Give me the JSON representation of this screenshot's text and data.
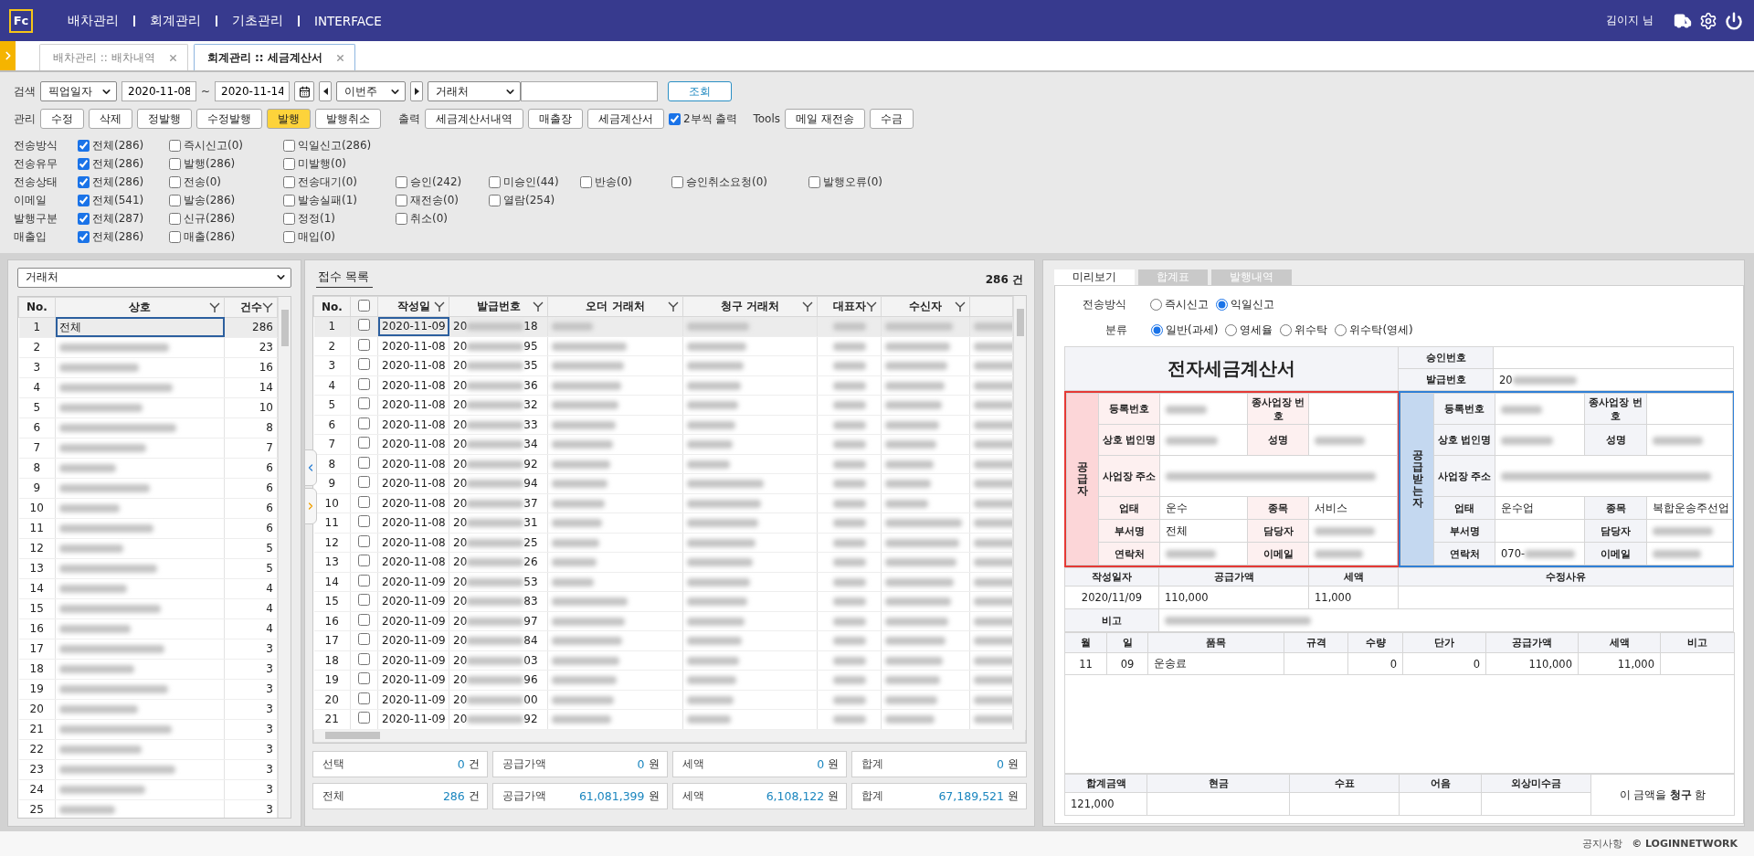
{
  "header": {
    "logo": "Fc",
    "menu": [
      {
        "label": "배차관리"
      },
      {
        "label": "회계관리"
      },
      {
        "label": "기초관리"
      },
      {
        "label": "INTERFACE"
      }
    ],
    "user": "김이지 님"
  },
  "tabs": [
    {
      "label": "배차관리 :: 배차내역",
      "selected": false
    },
    {
      "label": "회계관리 :: 세금계산서",
      "selected": true
    }
  ],
  "search": {
    "label": "검색",
    "date_type": "픽업일자",
    "date_from": "2020-11-08",
    "range_separator": "~",
    "date_to": "2020-11-14",
    "period": "이번주",
    "partner_type": "거래처",
    "button": "조회"
  },
  "manage": {
    "label": "관리",
    "buttons": [
      {
        "label": "수정",
        "highlighted": false
      },
      {
        "label": "삭제",
        "highlighted": false
      },
      {
        "label": "정발행",
        "highlighted": false
      },
      {
        "label": "수정발행",
        "highlighted": false
      },
      {
        "label": "발행",
        "highlighted": true
      },
      {
        "label": "발행취소",
        "highlighted": false
      }
    ]
  },
  "output": {
    "label": "출력",
    "buttons": [
      "세금계산서내역",
      "매출장",
      "세금계산서"
    ],
    "two_copies": {
      "label": "2부씩 출력",
      "checked": true
    }
  },
  "tools": {
    "label": "Tools",
    "buttons": [
      "메일 재전송",
      "수금"
    ]
  },
  "filters": [
    {
      "label": "전송방식",
      "options": [
        {
          "label": "전체(286)",
          "checked": true
        },
        {
          "label": "즉시신고(0)",
          "checked": false
        },
        {
          "label": "익일신고(286)",
          "checked": false
        }
      ]
    },
    {
      "label": "전송유무",
      "options": [
        {
          "label": "전체(286)",
          "checked": true
        },
        {
          "label": "발행(286)",
          "checked": false
        },
        {
          "label": "미발행(0)",
          "checked": false
        }
      ]
    },
    {
      "label": "전송상태",
      "options": [
        {
          "label": "전체(286)",
          "checked": true
        },
        {
          "label": "전송(0)",
          "checked": false
        },
        {
          "label": "전송대기(0)",
          "checked": false
        },
        {
          "label": "승인(242)",
          "checked": false
        },
        {
          "label": "미승인(44)",
          "checked": false
        },
        {
          "label": "반송(0)",
          "checked": false
        },
        {
          "label": "승인취소요청(0)",
          "checked": false
        },
        {
          "label": "발행오류(0)",
          "checked": false
        }
      ]
    },
    {
      "label": "이메일",
      "options": [
        {
          "label": "전체(541)",
          "checked": true
        },
        {
          "label": "발송(286)",
          "checked": false
        },
        {
          "label": "발송실패(1)",
          "checked": false
        },
        {
          "label": "재전송(0)",
          "checked": false
        },
        {
          "label": "열람(254)",
          "checked": false
        }
      ]
    },
    {
      "label": "발행구분",
      "options": [
        {
          "label": "전체(287)",
          "checked": true
        },
        {
          "label": "신규(286)",
          "checked": false
        },
        {
          "label": "정정(1)",
          "checked": false
        },
        {
          "label": "취소(0)",
          "checked": false
        }
      ]
    },
    {
      "label": "매출입",
      "options": [
        {
          "label": "전체(286)",
          "checked": true
        },
        {
          "label": "매출(286)",
          "checked": false
        },
        {
          "label": "매입(0)",
          "checked": false
        }
      ]
    }
  ],
  "partner_list": {
    "selector": "거래처",
    "columns": [
      {
        "label": "No.",
        "filter": false
      },
      {
        "label": "상호",
        "filter": true
      },
      {
        "label": "건수",
        "filter": true
      }
    ],
    "rows": [
      {
        "no": "1",
        "name": "전체",
        "count": "286",
        "selected": true
      },
      {
        "no": "2",
        "count": "23",
        "selected": false
      },
      {
        "no": "3",
        "count": "16",
        "selected": false
      },
      {
        "no": "4",
        "count": "14",
        "selected": false
      },
      {
        "no": "5",
        "count": "10",
        "selected": false
      },
      {
        "no": "6",
        "count": "8",
        "selected": false
      },
      {
        "no": "7",
        "count": "7",
        "selected": false
      },
      {
        "no": "8",
        "count": "6",
        "selected": false
      },
      {
        "no": "9",
        "count": "6",
        "selected": false
      },
      {
        "no": "10",
        "count": "6",
        "selected": false
      },
      {
        "no": "11",
        "count": "6",
        "selected": false
      },
      {
        "no": "12",
        "count": "5",
        "selected": false
      },
      {
        "no": "13",
        "count": "5",
        "selected": false
      },
      {
        "no": "14",
        "count": "4",
        "selected": false
      },
      {
        "no": "15",
        "count": "4",
        "selected": false
      },
      {
        "no": "16",
        "count": "4",
        "selected": false
      },
      {
        "no": "17",
        "count": "3",
        "selected": false
      },
      {
        "no": "18",
        "count": "3",
        "selected": false
      },
      {
        "no": "19",
        "count": "3",
        "selected": false
      },
      {
        "no": "20",
        "count": "3",
        "selected": false
      },
      {
        "no": "21",
        "count": "3",
        "selected": false
      },
      {
        "no": "22",
        "count": "3",
        "selected": false
      },
      {
        "no": "23",
        "count": "3",
        "selected": false
      },
      {
        "no": "24",
        "count": "3",
        "selected": false
      },
      {
        "no": "25",
        "count": "3",
        "selected": false
      }
    ]
  },
  "receipt_list": {
    "title": "접수 목록",
    "count": "286 건",
    "no_label": "No.",
    "header_checked": false,
    "columns": [
      {
        "label": "작성일",
        "filter": true
      },
      {
        "label": "발급번호",
        "filter": true
      },
      {
        "label": "오더 거래처",
        "filter": true
      },
      {
        "label": "청구 거래처",
        "filter": true
      },
      {
        "label": "대표자",
        "filter": true
      },
      {
        "label": "수신자",
        "filter": true
      }
    ],
    "rows": [
      {
        "no": "1",
        "checked": false,
        "date": "2020-11-09",
        "issue_prefix": "20",
        "issue_suffix": "18",
        "selected": true
      },
      {
        "no": "2",
        "checked": false,
        "date": "2020-11-08",
        "issue_prefix": "20",
        "issue_suffix": "95",
        "selected": false
      },
      {
        "no": "3",
        "checked": false,
        "date": "2020-11-08",
        "issue_prefix": "20",
        "issue_suffix": "35",
        "selected": false
      },
      {
        "no": "4",
        "checked": false,
        "date": "2020-11-08",
        "issue_prefix": "20",
        "issue_suffix": "36",
        "selected": false
      },
      {
        "no": "5",
        "checked": false,
        "date": "2020-11-08",
        "issue_prefix": "20",
        "issue_suffix": "32",
        "selected": false
      },
      {
        "no": "6",
        "checked": false,
        "date": "2020-11-08",
        "issue_prefix": "20",
        "issue_suffix": "33",
        "selected": false
      },
      {
        "no": "7",
        "checked": false,
        "date": "2020-11-08",
        "issue_prefix": "20",
        "issue_suffix": "34",
        "selected": false
      },
      {
        "no": "8",
        "checked": false,
        "date": "2020-11-08",
        "issue_prefix": "20",
        "issue_suffix": "92",
        "selected": false
      },
      {
        "no": "9",
        "checked": false,
        "date": "2020-11-08",
        "issue_prefix": "20",
        "issue_suffix": "94",
        "selected": false
      },
      {
        "no": "10",
        "checked": false,
        "date": "2020-11-08",
        "issue_prefix": "20",
        "issue_suffix": "37",
        "selected": false
      },
      {
        "no": "11",
        "checked": false,
        "date": "2020-11-08",
        "issue_prefix": "20",
        "issue_suffix": "31",
        "selected": false
      },
      {
        "no": "12",
        "checked": false,
        "date": "2020-11-08",
        "issue_prefix": "20",
        "issue_suffix": "25",
        "selected": false
      },
      {
        "no": "13",
        "checked": false,
        "date": "2020-11-08",
        "issue_prefix": "20",
        "issue_suffix": "26",
        "selected": false
      },
      {
        "no": "14",
        "checked": false,
        "date": "2020-11-09",
        "issue_prefix": "20",
        "issue_suffix": "53",
        "selected": false
      },
      {
        "no": "15",
        "checked": false,
        "date": "2020-11-09",
        "issue_prefix": "20",
        "issue_suffix": "83",
        "selected": false
      },
      {
        "no": "16",
        "checked": false,
        "date": "2020-11-09",
        "issue_prefix": "20",
        "issue_suffix": "97",
        "selected": false
      },
      {
        "no": "17",
        "checked": false,
        "date": "2020-11-09",
        "issue_prefix": "20",
        "issue_suffix": "84",
        "selected": false
      },
      {
        "no": "18",
        "checked": false,
        "date": "2020-11-09",
        "issue_prefix": "20",
        "issue_suffix": "03",
        "selected": false
      },
      {
        "no": "19",
        "checked": false,
        "date": "2020-11-09",
        "issue_prefix": "20",
        "issue_suffix": "96",
        "selected": false
      },
      {
        "no": "20",
        "checked": false,
        "date": "2020-11-09",
        "issue_prefix": "20",
        "issue_suffix": "00",
        "selected": false
      },
      {
        "no": "21",
        "checked": false,
        "date": "2020-11-09",
        "issue_prefix": "20",
        "issue_suffix": "92",
        "selected": false
      }
    ],
    "summary": [
      {
        "label": "선택",
        "value": "0",
        "unit": "건"
      },
      {
        "label": "공급가액",
        "value": "0",
        "unit": "원"
      },
      {
        "label": "세액",
        "value": "0",
        "unit": "원"
      },
      {
        "label": "합계",
        "value": "0",
        "unit": "원"
      },
      {
        "label": "전체",
        "value": "286",
        "unit": "건"
      },
      {
        "label": "공급가액",
        "value": "61,081,399",
        "unit": "원"
      },
      {
        "label": "세액",
        "value": "6,108,122",
        "unit": "원"
      },
      {
        "label": "합계",
        "value": "67,189,521",
        "unit": "원"
      }
    ]
  },
  "preview": {
    "tabs": [
      {
        "label": "미리보기",
        "selected": true
      },
      {
        "label": "합계표",
        "selected": false
      },
      {
        "label": "발행내역",
        "selected": false
      }
    ],
    "send_method": {
      "label": "전송방식",
      "options": [
        {
          "label": "즉시신고",
          "selected": false
        },
        {
          "label": "익일신고",
          "selected": true
        }
      ]
    },
    "category": {
      "label": "분류",
      "options": [
        {
          "label": "일반(과세)",
          "selected": true
        },
        {
          "label": "영세율",
          "selected": false
        },
        {
          "label": "위수탁",
          "selected": false
        },
        {
          "label": "위수탁(영세)",
          "selected": false
        }
      ]
    },
    "invoice": {
      "title": "전자세금계산서",
      "approval_label": "승인번호",
      "issue_label": "발급번호",
      "issue_value": "20",
      "supplier": {
        "side_label": "공급자",
        "rows": [
          {
            "fields": [
              {
                "label": "등록번호",
                "redacted": true
              },
              {
                "label": "종사업장 번호"
              }
            ]
          },
          {
            "fields": [
              {
                "label": "상호 법인명",
                "redacted": true
              },
              {
                "label": "성명",
                "redacted": true
              }
            ]
          },
          {
            "fields": [
              {
                "label": "사업장 주소",
                "redacted": true
              }
            ]
          },
          {
            "fields": [
              {
                "label": "업태",
                "value": "운수"
              },
              {
                "label": "종목",
                "value": "서비스"
              }
            ]
          },
          {
            "fields": [
              {
                "label": "부서명",
                "value": "전체"
              },
              {
                "label": "담당자",
                "redacted": true
              }
            ]
          },
          {
            "fields": [
              {
                "label": "연락처",
                "redacted": true
              },
              {
                "label": "이메일",
                "redacted": true
              }
            ]
          }
        ]
      },
      "receiver": {
        "side_label": "공급받는자",
        "rows": [
          {
            "fields": [
              {
                "label": "등록번호",
                "redacted": true
              },
              {
                "label": "종사업장 번호"
              }
            ]
          },
          {
            "fields": [
              {
                "label": "상호 법인명",
                "redacted": true
              },
              {
                "label": "성명",
                "redacted": true
              }
            ]
          },
          {
            "fields": [
              {
                "label": "사업장 주소",
                "redacted": true
              }
            ]
          },
          {
            "fields": [
              {
                "label": "업태",
                "value": "운수업"
              },
              {
                "label": "종목",
                "value": "복합운송주선업"
              }
            ]
          },
          {
            "fields": [
              {
                "label": "부서명"
              },
              {
                "label": "담당자",
                "redacted": true
              }
            ]
          },
          {
            "fields": [
              {
                "label": "연락처",
                "value": "070-",
                "redacted": true
              },
              {
                "label": "이메일",
                "redacted": true
              }
            ]
          }
        ]
      },
      "amounts": [
        {
          "label": "작성일자",
          "value": "2020/11/09"
        },
        {
          "label": "공급가액",
          "value": "110,000"
        },
        {
          "label": "세액",
          "value": "11,000"
        },
        {
          "label": "수정사유"
        }
      ],
      "note_label": "비고",
      "item_columns": [
        "월",
        "일",
        "품목",
        "규격",
        "수량",
        "단가",
        "공급가액",
        "세액",
        "비고"
      ],
      "items": [
        {
          "month": "11",
          "day": "09",
          "name": "운송료",
          "quantity": "0",
          "unit_price": "0",
          "supply": "110,000",
          "tax": "11,000"
        }
      ],
      "totals": [
        {
          "label": "합계금액",
          "value": "121,000"
        },
        {
          "label": "현금"
        },
        {
          "label": "수표"
        },
        {
          "label": "어음"
        },
        {
          "label": "외상미수금"
        }
      ],
      "claim": "이 금액을  **청구**  함"
    }
  },
  "footer": {
    "notice": "공지사항",
    "copyright": "© LOGINNETWORK"
  }
}
